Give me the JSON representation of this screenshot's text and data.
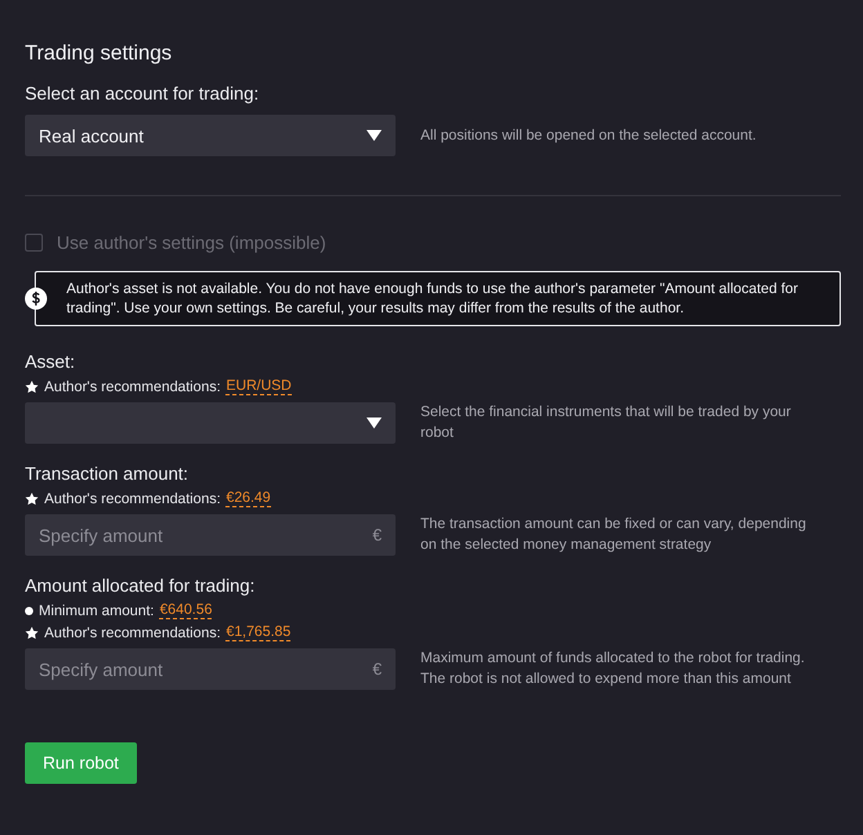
{
  "title": "Trading settings",
  "account": {
    "label": "Select an account for trading:",
    "value": "Real account",
    "hint": "All positions will be opened on the selected account."
  },
  "author_settings": {
    "label": "Use author's settings (impossible)",
    "checked": false,
    "disabled": true
  },
  "alert": {
    "text": "Author's asset is not available. You do not have enough funds to use the author's parameter \"Amount allocated for trading\". Use your own settings. Be careful, your results may differ from the results of the author."
  },
  "sections": [
    {
      "label": "Asset:",
      "recommendations": [
        {
          "kind": "star",
          "label": "Author's recommendations:",
          "value": "EUR/USD"
        }
      ],
      "field": {
        "kind": "select"
      },
      "hint": "Select the financial instruments that will be traded by your robot"
    },
    {
      "label": "Transaction amount:",
      "recommendations": [
        {
          "kind": "star",
          "label": "Author's recommendations:",
          "value": "€26.49"
        }
      ],
      "field": {
        "kind": "input",
        "placeholder": "Specify amount",
        "currency": "€"
      },
      "hint": "The transaction amount can be fixed or can vary, depending on the selected money management strategy"
    },
    {
      "label": "Amount allocated for trading:",
      "recommendations": [
        {
          "kind": "dot",
          "label": "Minimum amount:",
          "value": "€640.56"
        },
        {
          "kind": "star",
          "label": "Author's recommendations:",
          "value": "€1,765.85"
        }
      ],
      "field": {
        "kind": "input",
        "placeholder": "Specify amount",
        "currency": "€"
      },
      "hint": "Maximum amount of funds allocated to the robot for trading. The robot is not allowed to expend more than this amount"
    }
  ],
  "button": "Run robot"
}
